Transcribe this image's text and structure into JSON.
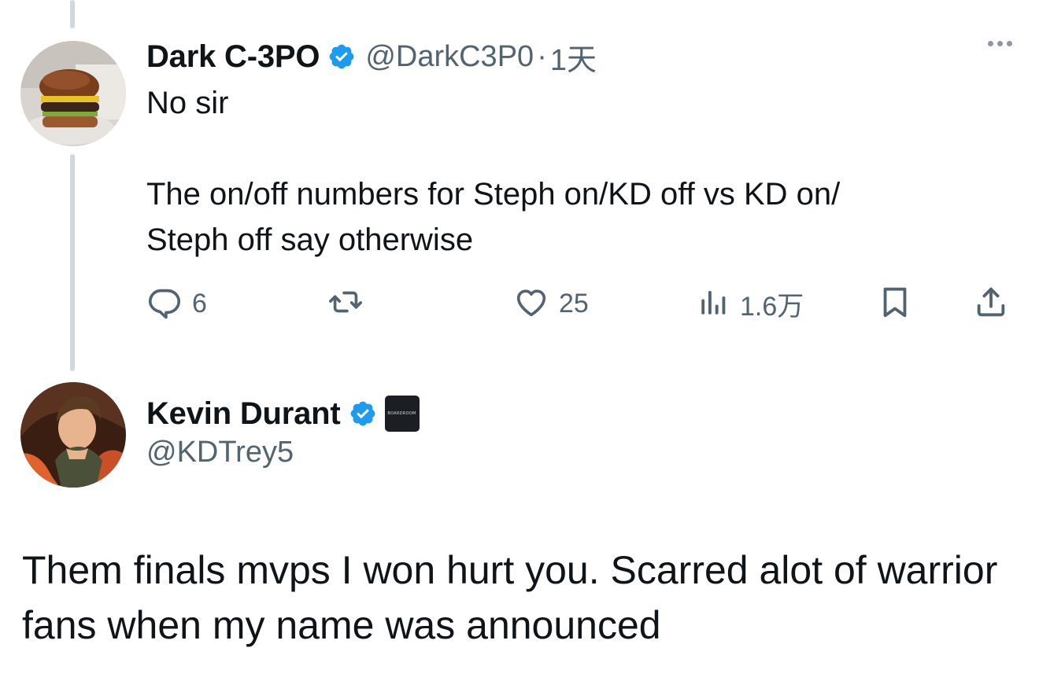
{
  "reply_tweet": {
    "author": {
      "display_name": "Dark C-3PO",
      "handle": "@DarkC3P0",
      "verified": true,
      "avatar": "burger-photo"
    },
    "separator": "·",
    "time": "1天",
    "text_line1": "No sir",
    "text_paragraph2": "The on/off numbers for Steph on/KD off vs KD on/\nSteph off say otherwise",
    "actions": {
      "replies": "6",
      "retweets": "",
      "likes": "25",
      "views": "1.6万"
    },
    "more_icon": "ellipsis-icon"
  },
  "main_tweet": {
    "author": {
      "display_name": "Kevin Durant",
      "handle": "@KDTrey5",
      "verified": true,
      "affiliation_badge": "BOARDROOM",
      "avatar": "animated-character"
    },
    "text": "Them finals mvps I won hurt you. Scarred alot of warrior fans when my name was announced"
  },
  "colors": {
    "text_primary": "#0f1419",
    "text_secondary": "#536471",
    "verified_blue": "#1d9bf0",
    "thread_line": "#cfd9de"
  }
}
